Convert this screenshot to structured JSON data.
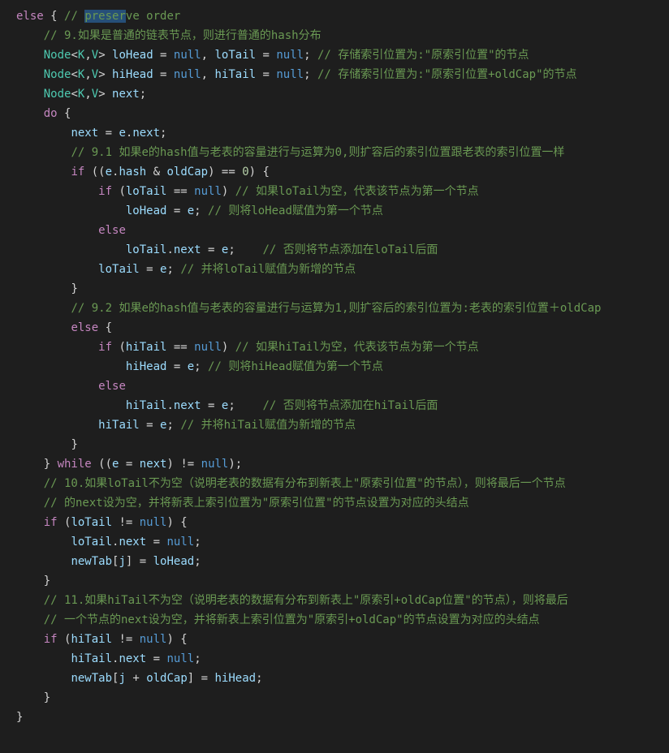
{
  "code": {
    "lines": [
      {
        "indent": 0,
        "segments": [
          {
            "cls": "tok-kw",
            "t": "else"
          },
          {
            "cls": "tok-punc",
            "t": " { "
          },
          {
            "cls": "tok-cmt",
            "t": "// "
          },
          {
            "cls": "tok-cmt sel",
            "t": "preser"
          },
          {
            "cls": "tok-cmt",
            "t": "ve order"
          }
        ]
      },
      {
        "indent": 1,
        "segments": [
          {
            "cls": "tok-cmt",
            "t": "// 9.如果是普通的链表节点，则进行普通的hash分布"
          }
        ]
      },
      {
        "indent": 1,
        "segments": [
          {
            "cls": "tok-type",
            "t": "Node"
          },
          {
            "cls": "tok-punc",
            "t": "<"
          },
          {
            "cls": "tok-type",
            "t": "K"
          },
          {
            "cls": "tok-punc",
            "t": ","
          },
          {
            "cls": "tok-type",
            "t": "V"
          },
          {
            "cls": "tok-punc",
            "t": "> "
          },
          {
            "cls": "tok-var",
            "t": "loHead"
          },
          {
            "cls": "tok-punc",
            "t": " = "
          },
          {
            "cls": "tok-null",
            "t": "null"
          },
          {
            "cls": "tok-punc",
            "t": ", "
          },
          {
            "cls": "tok-var",
            "t": "loTail"
          },
          {
            "cls": "tok-punc",
            "t": " = "
          },
          {
            "cls": "tok-null",
            "t": "null"
          },
          {
            "cls": "tok-punc",
            "t": "; "
          },
          {
            "cls": "tok-cmt",
            "t": "// 存储索引位置为:\"原索引位置\"的节点"
          }
        ]
      },
      {
        "indent": 1,
        "segments": [
          {
            "cls": "tok-type",
            "t": "Node"
          },
          {
            "cls": "tok-punc",
            "t": "<"
          },
          {
            "cls": "tok-type",
            "t": "K"
          },
          {
            "cls": "tok-punc",
            "t": ","
          },
          {
            "cls": "tok-type",
            "t": "V"
          },
          {
            "cls": "tok-punc",
            "t": "> "
          },
          {
            "cls": "tok-var",
            "t": "hiHead"
          },
          {
            "cls": "tok-punc",
            "t": " = "
          },
          {
            "cls": "tok-null",
            "t": "null"
          },
          {
            "cls": "tok-punc",
            "t": ", "
          },
          {
            "cls": "tok-var",
            "t": "hiTail"
          },
          {
            "cls": "tok-punc",
            "t": " = "
          },
          {
            "cls": "tok-null",
            "t": "null"
          },
          {
            "cls": "tok-punc",
            "t": "; "
          },
          {
            "cls": "tok-cmt",
            "t": "// 存储索引位置为:\"原索引位置+oldCap\"的节点"
          }
        ]
      },
      {
        "indent": 1,
        "segments": [
          {
            "cls": "tok-type",
            "t": "Node"
          },
          {
            "cls": "tok-punc",
            "t": "<"
          },
          {
            "cls": "tok-type",
            "t": "K"
          },
          {
            "cls": "tok-punc",
            "t": ","
          },
          {
            "cls": "tok-type",
            "t": "V"
          },
          {
            "cls": "tok-punc",
            "t": "> "
          },
          {
            "cls": "tok-var",
            "t": "next"
          },
          {
            "cls": "tok-punc",
            "t": ";"
          }
        ]
      },
      {
        "indent": 1,
        "segments": [
          {
            "cls": "tok-kw",
            "t": "do"
          },
          {
            "cls": "tok-punc",
            "t": " {"
          }
        ]
      },
      {
        "indent": 2,
        "segments": [
          {
            "cls": "tok-var",
            "t": "next"
          },
          {
            "cls": "tok-punc",
            "t": " = "
          },
          {
            "cls": "tok-var",
            "t": "e"
          },
          {
            "cls": "tok-punc",
            "t": "."
          },
          {
            "cls": "tok-var",
            "t": "next"
          },
          {
            "cls": "tok-punc",
            "t": ";"
          }
        ]
      },
      {
        "indent": 2,
        "segments": [
          {
            "cls": "tok-cmt",
            "t": "// 9.1 如果e的hash值与老表的容量进行与运算为0,则扩容后的索引位置跟老表的索引位置一样"
          }
        ]
      },
      {
        "indent": 2,
        "segments": [
          {
            "cls": "tok-kw",
            "t": "if"
          },
          {
            "cls": "tok-punc",
            "t": " (("
          },
          {
            "cls": "tok-var",
            "t": "e"
          },
          {
            "cls": "tok-punc",
            "t": "."
          },
          {
            "cls": "tok-var",
            "t": "hash"
          },
          {
            "cls": "tok-punc",
            "t": " & "
          },
          {
            "cls": "tok-var",
            "t": "oldCap"
          },
          {
            "cls": "tok-punc",
            "t": ") == "
          },
          {
            "cls": "tok-num",
            "t": "0"
          },
          {
            "cls": "tok-punc",
            "t": ") {"
          }
        ]
      },
      {
        "indent": 3,
        "segments": [
          {
            "cls": "tok-kw",
            "t": "if"
          },
          {
            "cls": "tok-punc",
            "t": " ("
          },
          {
            "cls": "tok-var",
            "t": "loTail"
          },
          {
            "cls": "tok-punc",
            "t": " == "
          },
          {
            "cls": "tok-null",
            "t": "null"
          },
          {
            "cls": "tok-punc",
            "t": ") "
          },
          {
            "cls": "tok-cmt",
            "t": "// 如果loTail为空，代表该节点为第一个节点"
          }
        ]
      },
      {
        "indent": 4,
        "segments": [
          {
            "cls": "tok-var",
            "t": "loHead"
          },
          {
            "cls": "tok-punc",
            "t": " = "
          },
          {
            "cls": "tok-var",
            "t": "e"
          },
          {
            "cls": "tok-punc",
            "t": "; "
          },
          {
            "cls": "tok-cmt",
            "t": "// 则将loHead赋值为第一个节点"
          }
        ]
      },
      {
        "indent": 3,
        "segments": [
          {
            "cls": "tok-kw",
            "t": "else"
          }
        ]
      },
      {
        "indent": 4,
        "segments": [
          {
            "cls": "tok-var",
            "t": "loTail"
          },
          {
            "cls": "tok-punc",
            "t": "."
          },
          {
            "cls": "tok-var",
            "t": "next"
          },
          {
            "cls": "tok-punc",
            "t": " = "
          },
          {
            "cls": "tok-var",
            "t": "e"
          },
          {
            "cls": "tok-punc",
            "t": ";    "
          },
          {
            "cls": "tok-cmt",
            "t": "// 否则将节点添加在loTail后面"
          }
        ]
      },
      {
        "indent": 3,
        "segments": [
          {
            "cls": "tok-var",
            "t": "loTail"
          },
          {
            "cls": "tok-punc",
            "t": " = "
          },
          {
            "cls": "tok-var",
            "t": "e"
          },
          {
            "cls": "tok-punc",
            "t": "; "
          },
          {
            "cls": "tok-cmt",
            "t": "// 并将loTail赋值为新增的节点"
          }
        ]
      },
      {
        "indent": 2,
        "segments": [
          {
            "cls": "tok-punc",
            "t": "}"
          }
        ]
      },
      {
        "indent": 2,
        "segments": [
          {
            "cls": "tok-cmt",
            "t": "// 9.2 如果e的hash值与老表的容量进行与运算为1,则扩容后的索引位置为:老表的索引位置＋oldCap"
          }
        ]
      },
      {
        "indent": 2,
        "segments": [
          {
            "cls": "tok-kw",
            "t": "else"
          },
          {
            "cls": "tok-punc",
            "t": " {"
          }
        ]
      },
      {
        "indent": 3,
        "segments": [
          {
            "cls": "tok-kw",
            "t": "if"
          },
          {
            "cls": "tok-punc",
            "t": " ("
          },
          {
            "cls": "tok-var",
            "t": "hiTail"
          },
          {
            "cls": "tok-punc",
            "t": " == "
          },
          {
            "cls": "tok-null",
            "t": "null"
          },
          {
            "cls": "tok-punc",
            "t": ") "
          },
          {
            "cls": "tok-cmt",
            "t": "// 如果hiTail为空，代表该节点为第一个节点"
          }
        ]
      },
      {
        "indent": 4,
        "segments": [
          {
            "cls": "tok-var",
            "t": "hiHead"
          },
          {
            "cls": "tok-punc",
            "t": " = "
          },
          {
            "cls": "tok-var",
            "t": "e"
          },
          {
            "cls": "tok-punc",
            "t": "; "
          },
          {
            "cls": "tok-cmt",
            "t": "// 则将hiHead赋值为第一个节点"
          }
        ]
      },
      {
        "indent": 3,
        "segments": [
          {
            "cls": "tok-kw",
            "t": "else"
          }
        ]
      },
      {
        "indent": 4,
        "segments": [
          {
            "cls": "tok-var",
            "t": "hiTail"
          },
          {
            "cls": "tok-punc",
            "t": "."
          },
          {
            "cls": "tok-var",
            "t": "next"
          },
          {
            "cls": "tok-punc",
            "t": " = "
          },
          {
            "cls": "tok-var",
            "t": "e"
          },
          {
            "cls": "tok-punc",
            "t": ";    "
          },
          {
            "cls": "tok-cmt",
            "t": "// 否则将节点添加在hiTail后面"
          }
        ]
      },
      {
        "indent": 3,
        "segments": [
          {
            "cls": "tok-var",
            "t": "hiTail"
          },
          {
            "cls": "tok-punc",
            "t": " = "
          },
          {
            "cls": "tok-var",
            "t": "e"
          },
          {
            "cls": "tok-punc",
            "t": "; "
          },
          {
            "cls": "tok-cmt",
            "t": "// 并将hiTail赋值为新增的节点"
          }
        ]
      },
      {
        "indent": 2,
        "segments": [
          {
            "cls": "tok-punc",
            "t": "}"
          }
        ]
      },
      {
        "indent": 1,
        "segments": [
          {
            "cls": "tok-punc",
            "t": "} "
          },
          {
            "cls": "tok-kw",
            "t": "while"
          },
          {
            "cls": "tok-punc",
            "t": " (("
          },
          {
            "cls": "tok-var",
            "t": "e"
          },
          {
            "cls": "tok-punc",
            "t": " = "
          },
          {
            "cls": "tok-var",
            "t": "next"
          },
          {
            "cls": "tok-punc",
            "t": ") != "
          },
          {
            "cls": "tok-null",
            "t": "null"
          },
          {
            "cls": "tok-punc",
            "t": ");"
          }
        ]
      },
      {
        "indent": 1,
        "segments": [
          {
            "cls": "tok-cmt",
            "t": "// 10.如果loTail不为空（说明老表的数据有分布到新表上\"原索引位置\"的节点），则将最后一个节点"
          }
        ]
      },
      {
        "indent": 1,
        "segments": [
          {
            "cls": "tok-cmt",
            "t": "// 的next设为空，并将新表上索引位置为\"原索引位置\"的节点设置为对应的头结点"
          }
        ]
      },
      {
        "indent": 1,
        "segments": [
          {
            "cls": "tok-kw",
            "t": "if"
          },
          {
            "cls": "tok-punc",
            "t": " ("
          },
          {
            "cls": "tok-var",
            "t": "loTail"
          },
          {
            "cls": "tok-punc",
            "t": " != "
          },
          {
            "cls": "tok-null",
            "t": "null"
          },
          {
            "cls": "tok-punc",
            "t": ") {"
          }
        ]
      },
      {
        "indent": 2,
        "segments": [
          {
            "cls": "tok-var",
            "t": "loTail"
          },
          {
            "cls": "tok-punc",
            "t": "."
          },
          {
            "cls": "tok-var",
            "t": "next"
          },
          {
            "cls": "tok-punc",
            "t": " = "
          },
          {
            "cls": "tok-null",
            "t": "null"
          },
          {
            "cls": "tok-punc",
            "t": ";"
          }
        ]
      },
      {
        "indent": 2,
        "segments": [
          {
            "cls": "tok-var",
            "t": "newTab"
          },
          {
            "cls": "tok-punc",
            "t": "["
          },
          {
            "cls": "tok-var",
            "t": "j"
          },
          {
            "cls": "tok-punc",
            "t": "] = "
          },
          {
            "cls": "tok-var",
            "t": "loHead"
          },
          {
            "cls": "tok-punc",
            "t": ";"
          }
        ]
      },
      {
        "indent": 1,
        "segments": [
          {
            "cls": "tok-punc",
            "t": "}"
          }
        ]
      },
      {
        "indent": 1,
        "segments": [
          {
            "cls": "tok-cmt",
            "t": "// 11.如果hiTail不为空（说明老表的数据有分布到新表上\"原索引+oldCap位置\"的节点），则将最后"
          }
        ]
      },
      {
        "indent": 1,
        "segments": [
          {
            "cls": "tok-cmt",
            "t": "// 一个节点的next设为空，并将新表上索引位置为\"原索引+oldCap\"的节点设置为对应的头结点"
          }
        ]
      },
      {
        "indent": 1,
        "segments": [
          {
            "cls": "tok-kw",
            "t": "if"
          },
          {
            "cls": "tok-punc",
            "t": " ("
          },
          {
            "cls": "tok-var",
            "t": "hiTail"
          },
          {
            "cls": "tok-punc",
            "t": " != "
          },
          {
            "cls": "tok-null",
            "t": "null"
          },
          {
            "cls": "tok-punc",
            "t": ") {"
          }
        ]
      },
      {
        "indent": 2,
        "segments": [
          {
            "cls": "tok-var",
            "t": "hiTail"
          },
          {
            "cls": "tok-punc",
            "t": "."
          },
          {
            "cls": "tok-var",
            "t": "next"
          },
          {
            "cls": "tok-punc",
            "t": " = "
          },
          {
            "cls": "tok-null",
            "t": "null"
          },
          {
            "cls": "tok-punc",
            "t": ";"
          }
        ]
      },
      {
        "indent": 2,
        "segments": [
          {
            "cls": "tok-var",
            "t": "newTab"
          },
          {
            "cls": "tok-punc",
            "t": "["
          },
          {
            "cls": "tok-var",
            "t": "j"
          },
          {
            "cls": "tok-punc",
            "t": " + "
          },
          {
            "cls": "tok-var",
            "t": "oldCap"
          },
          {
            "cls": "tok-punc",
            "t": "] = "
          },
          {
            "cls": "tok-var",
            "t": "hiHead"
          },
          {
            "cls": "tok-punc",
            "t": ";"
          }
        ]
      },
      {
        "indent": 1,
        "segments": [
          {
            "cls": "tok-punc",
            "t": "}"
          }
        ]
      },
      {
        "indent": 0,
        "segments": [
          {
            "cls": "tok-punc",
            "t": "}"
          }
        ]
      }
    ]
  }
}
